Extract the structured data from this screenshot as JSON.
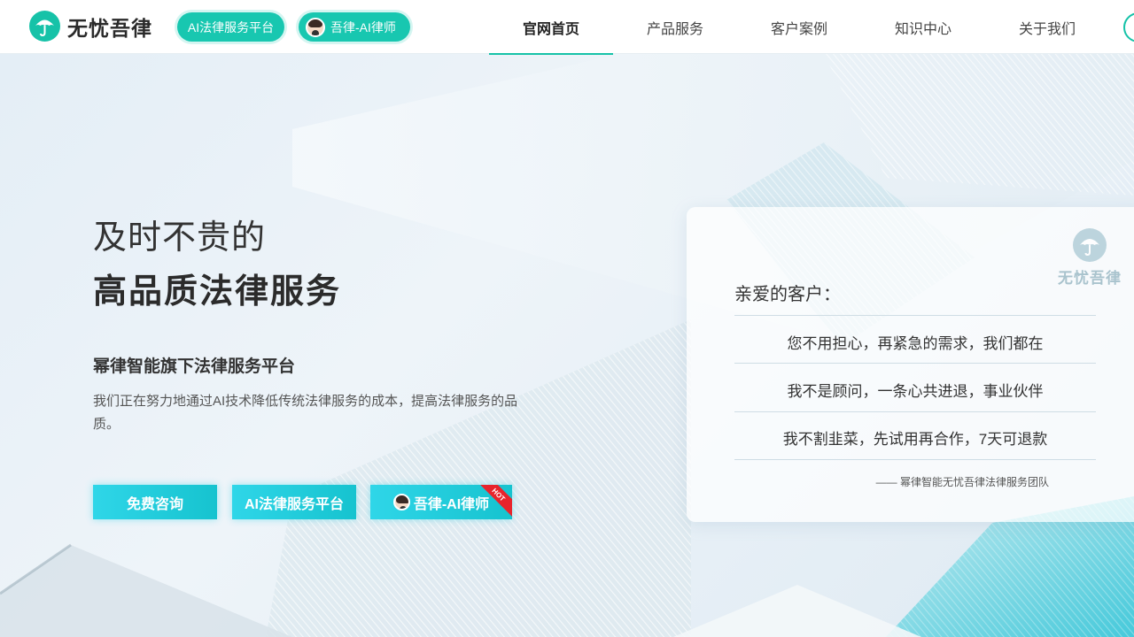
{
  "header": {
    "logo_text": "无忧吾律",
    "pill_platform": "AI法律服务平台",
    "pill_ai_lawyer": "吾律-AI律师",
    "nav": [
      {
        "label": "官网首页",
        "active": true
      },
      {
        "label": "产品服务",
        "active": false
      },
      {
        "label": "客户案例",
        "active": false
      },
      {
        "label": "知识中心",
        "active": false
      },
      {
        "label": "关于我们",
        "active": false
      }
    ]
  },
  "hero": {
    "title_line1": "及时不贵的",
    "title_line2": "高品质法律服务",
    "subtitle": "幂律智能旗下法律服务平台",
    "description": "我们正在努力地通过AI技术降低传统法律服务的成本，提高法律服务的品质。",
    "buttons": {
      "free_consult": "免费咨询",
      "platform": "AI法律服务平台",
      "ai_lawyer": "吾律-AI律师",
      "hot_badge": "HOT"
    }
  },
  "card": {
    "watermark_text": "无忧吾律",
    "greeting": "亲爱的客户：",
    "lines": [
      "您不用担心，再紧急的需求，我们都在",
      "我不是顾问，一条心共进退，事业伙伴",
      "我不割韭菜，先试用再合作，7天可退款"
    ],
    "signature": "—— 幂律智能无忧吾律法律服务团队"
  },
  "colors": {
    "brand": "#16c2a8",
    "cta": "#1fcfdc",
    "hot": "#e8242c"
  },
  "icons": {
    "logo": "umbrella-icon",
    "avatar": "lawyer-avatar-icon"
  }
}
